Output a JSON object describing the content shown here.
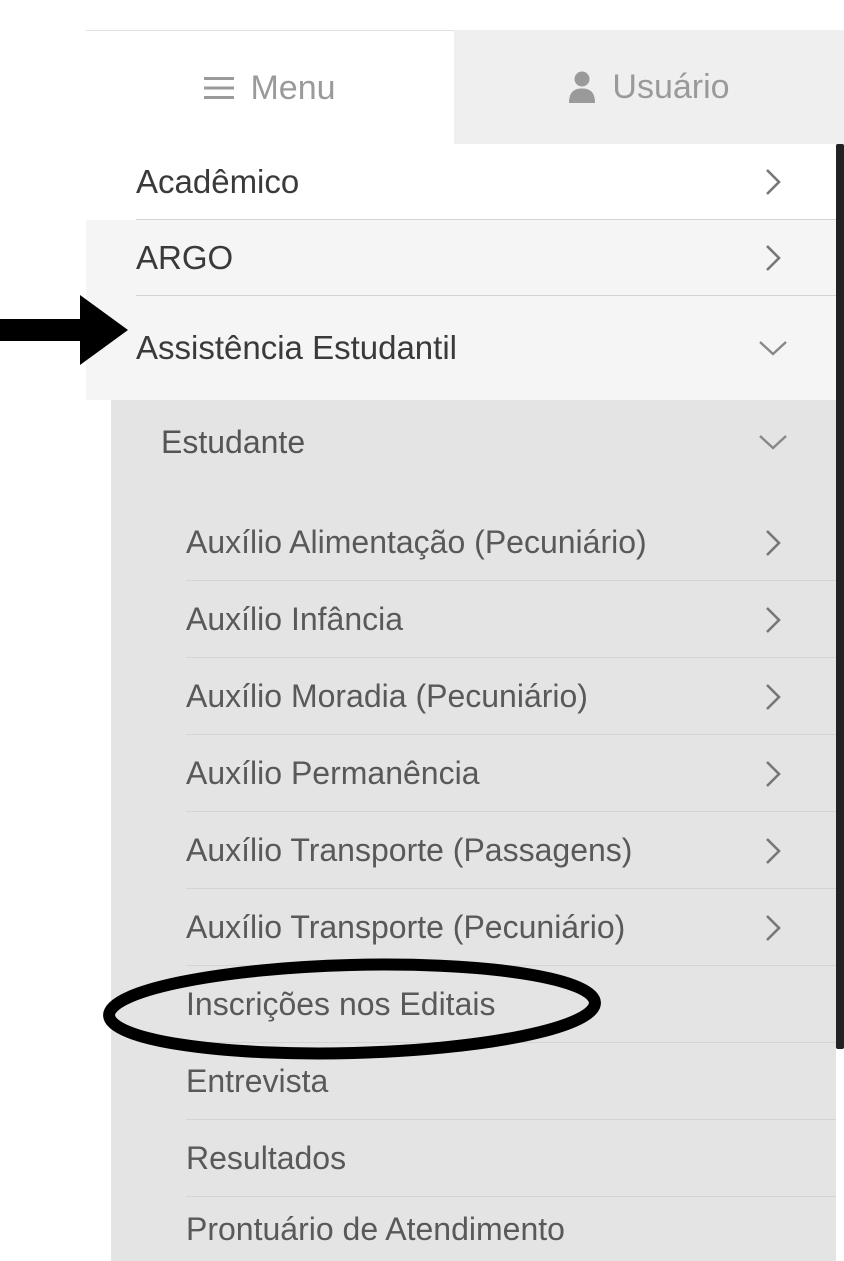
{
  "tabs": {
    "menu": {
      "label": "Menu",
      "icon": "hamburger-icon"
    },
    "user": {
      "label": "Usuário",
      "icon": "user-icon"
    }
  },
  "menu": {
    "items": [
      {
        "label": "Acadêmico",
        "icon": "chevron-right-icon"
      },
      {
        "label": "ARGO",
        "icon": "chevron-right-icon"
      },
      {
        "label": "Assistência Estudantil",
        "icon": "chevron-down-icon",
        "expanded": true
      }
    ],
    "submenu": {
      "label": "Estudante",
      "icon": "chevron-down-icon",
      "expanded": true,
      "items": [
        {
          "label": "Auxílio Alimentação (Pecuniário)",
          "icon": "chevron-right-icon"
        },
        {
          "label": "Auxílio Infância",
          "icon": "chevron-right-icon"
        },
        {
          "label": "Auxílio Moradia (Pecuniário)",
          "icon": "chevron-right-icon"
        },
        {
          "label": "Auxílio Permanência",
          "icon": "chevron-right-icon"
        },
        {
          "label": "Auxílio Transporte (Passagens)",
          "icon": "chevron-right-icon"
        },
        {
          "label": "Auxílio Transporte (Pecuniário)",
          "icon": "chevron-right-icon"
        },
        {
          "label": "Inscrições nos Editais",
          "highlighted": true
        },
        {
          "label": "Entrevista"
        },
        {
          "label": "Resultados"
        },
        {
          "label": "Prontuário de Atendimento"
        }
      ]
    }
  },
  "annotations": {
    "arrow": {
      "color": "#000000",
      "points_to": "Assistência Estudantil"
    },
    "circle": {
      "color": "#000000",
      "surrounds": "Inscrições nos Editais"
    }
  },
  "colors": {
    "tab_text": "#9a9a9a",
    "submenu_background": "#e4e4e4",
    "scrollbar": "#222222"
  }
}
